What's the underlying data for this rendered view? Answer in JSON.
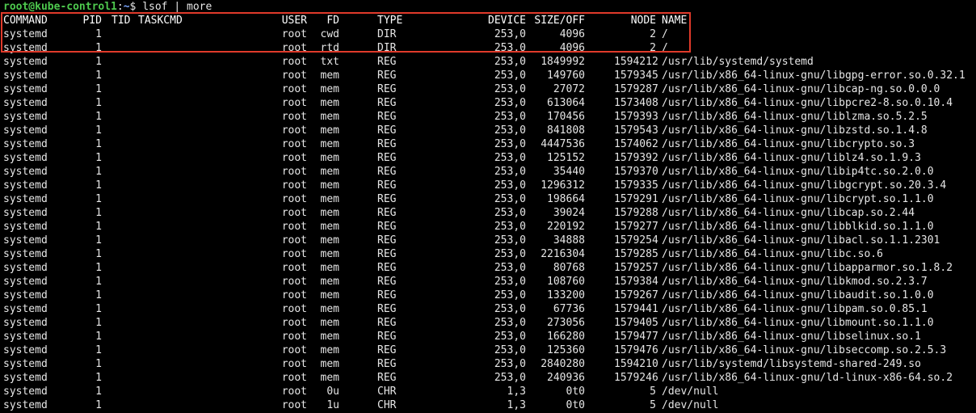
{
  "prompt": {
    "user_host": "root@kube-control1",
    "separator": ":",
    "path": "~",
    "symbol": "$",
    "command": " lsof | more"
  },
  "colors": {
    "background": "#000000",
    "text": "#e6e6e6",
    "prompt_user": "#4ec94e",
    "prompt_path": "#7aa6ff",
    "highlight_box": "#e03a2a"
  },
  "table": {
    "headers": {
      "command": "COMMAND",
      "pid": "PID",
      "tid": "TID",
      "taskcmd": "TASKCMD",
      "user": "USER",
      "fd": "FD",
      "type": "TYPE",
      "device": "DEVICE",
      "size": "SIZE/OFF",
      "node": "NODE",
      "name": "NAME"
    },
    "rows": [
      {
        "command": "systemd",
        "pid": "1",
        "user": "root",
        "fd": "cwd",
        "type": "DIR",
        "device": "253,0",
        "size": "4096",
        "node": "2",
        "name": "/"
      },
      {
        "command": "systemd",
        "pid": "1",
        "user": "root",
        "fd": "rtd",
        "type": "DIR",
        "device": "253,0",
        "size": "4096",
        "node": "2",
        "name": "/"
      },
      {
        "command": "systemd",
        "pid": "1",
        "user": "root",
        "fd": "txt",
        "type": "REG",
        "device": "253,0",
        "size": "1849992",
        "node": "1594212",
        "name": "/usr/lib/systemd/systemd"
      },
      {
        "command": "systemd",
        "pid": "1",
        "user": "root",
        "fd": "mem",
        "type": "REG",
        "device": "253,0",
        "size": "149760",
        "node": "1579345",
        "name": "/usr/lib/x86_64-linux-gnu/libgpg-error.so.0.32.1"
      },
      {
        "command": "systemd",
        "pid": "1",
        "user": "root",
        "fd": "mem",
        "type": "REG",
        "device": "253,0",
        "size": "27072",
        "node": "1579287",
        "name": "/usr/lib/x86_64-linux-gnu/libcap-ng.so.0.0.0"
      },
      {
        "command": "systemd",
        "pid": "1",
        "user": "root",
        "fd": "mem",
        "type": "REG",
        "device": "253,0",
        "size": "613064",
        "node": "1573408",
        "name": "/usr/lib/x86_64-linux-gnu/libpcre2-8.so.0.10.4"
      },
      {
        "command": "systemd",
        "pid": "1",
        "user": "root",
        "fd": "mem",
        "type": "REG",
        "device": "253,0",
        "size": "170456",
        "node": "1579393",
        "name": "/usr/lib/x86_64-linux-gnu/liblzma.so.5.2.5"
      },
      {
        "command": "systemd",
        "pid": "1",
        "user": "root",
        "fd": "mem",
        "type": "REG",
        "device": "253,0",
        "size": "841808",
        "node": "1579543",
        "name": "/usr/lib/x86_64-linux-gnu/libzstd.so.1.4.8"
      },
      {
        "command": "systemd",
        "pid": "1",
        "user": "root",
        "fd": "mem",
        "type": "REG",
        "device": "253,0",
        "size": "4447536",
        "node": "1574062",
        "name": "/usr/lib/x86_64-linux-gnu/libcrypto.so.3"
      },
      {
        "command": "systemd",
        "pid": "1",
        "user": "root",
        "fd": "mem",
        "type": "REG",
        "device": "253,0",
        "size": "125152",
        "node": "1579392",
        "name": "/usr/lib/x86_64-linux-gnu/liblz4.so.1.9.3"
      },
      {
        "command": "systemd",
        "pid": "1",
        "user": "root",
        "fd": "mem",
        "type": "REG",
        "device": "253,0",
        "size": "35440",
        "node": "1579370",
        "name": "/usr/lib/x86_64-linux-gnu/libip4tc.so.2.0.0"
      },
      {
        "command": "systemd",
        "pid": "1",
        "user": "root",
        "fd": "mem",
        "type": "REG",
        "device": "253,0",
        "size": "1296312",
        "node": "1579335",
        "name": "/usr/lib/x86_64-linux-gnu/libgcrypt.so.20.3.4"
      },
      {
        "command": "systemd",
        "pid": "1",
        "user": "root",
        "fd": "mem",
        "type": "REG",
        "device": "253,0",
        "size": "198664",
        "node": "1579291",
        "name": "/usr/lib/x86_64-linux-gnu/libcrypt.so.1.1.0"
      },
      {
        "command": "systemd",
        "pid": "1",
        "user": "root",
        "fd": "mem",
        "type": "REG",
        "device": "253,0",
        "size": "39024",
        "node": "1579288",
        "name": "/usr/lib/x86_64-linux-gnu/libcap.so.2.44"
      },
      {
        "command": "systemd",
        "pid": "1",
        "user": "root",
        "fd": "mem",
        "type": "REG",
        "device": "253,0",
        "size": "220192",
        "node": "1579277",
        "name": "/usr/lib/x86_64-linux-gnu/libblkid.so.1.1.0"
      },
      {
        "command": "systemd",
        "pid": "1",
        "user": "root",
        "fd": "mem",
        "type": "REG",
        "device": "253,0",
        "size": "34888",
        "node": "1579254",
        "name": "/usr/lib/x86_64-linux-gnu/libacl.so.1.1.2301"
      },
      {
        "command": "systemd",
        "pid": "1",
        "user": "root",
        "fd": "mem",
        "type": "REG",
        "device": "253,0",
        "size": "2216304",
        "node": "1579285",
        "name": "/usr/lib/x86_64-linux-gnu/libc.so.6"
      },
      {
        "command": "systemd",
        "pid": "1",
        "user": "root",
        "fd": "mem",
        "type": "REG",
        "device": "253,0",
        "size": "80768",
        "node": "1579257",
        "name": "/usr/lib/x86_64-linux-gnu/libapparmor.so.1.8.2"
      },
      {
        "command": "systemd",
        "pid": "1",
        "user": "root",
        "fd": "mem",
        "type": "REG",
        "device": "253,0",
        "size": "108760",
        "node": "1579384",
        "name": "/usr/lib/x86_64-linux-gnu/libkmod.so.2.3.7"
      },
      {
        "command": "systemd",
        "pid": "1",
        "user": "root",
        "fd": "mem",
        "type": "REG",
        "device": "253,0",
        "size": "133200",
        "node": "1579267",
        "name": "/usr/lib/x86_64-linux-gnu/libaudit.so.1.0.0"
      },
      {
        "command": "systemd",
        "pid": "1",
        "user": "root",
        "fd": "mem",
        "type": "REG",
        "device": "253,0",
        "size": "67736",
        "node": "1579441",
        "name": "/usr/lib/x86_64-linux-gnu/libpam.so.0.85.1"
      },
      {
        "command": "systemd",
        "pid": "1",
        "user": "root",
        "fd": "mem",
        "type": "REG",
        "device": "253,0",
        "size": "273056",
        "node": "1579405",
        "name": "/usr/lib/x86_64-linux-gnu/libmount.so.1.1.0"
      },
      {
        "command": "systemd",
        "pid": "1",
        "user": "root",
        "fd": "mem",
        "type": "REG",
        "device": "253,0",
        "size": "166280",
        "node": "1579477",
        "name": "/usr/lib/x86_64-linux-gnu/libselinux.so.1"
      },
      {
        "command": "systemd",
        "pid": "1",
        "user": "root",
        "fd": "mem",
        "type": "REG",
        "device": "253,0",
        "size": "125360",
        "node": "1579476",
        "name": "/usr/lib/x86_64-linux-gnu/libseccomp.so.2.5.3"
      },
      {
        "command": "systemd",
        "pid": "1",
        "user": "root",
        "fd": "mem",
        "type": "REG",
        "device": "253,0",
        "size": "2840280",
        "node": "1594210",
        "name": "/usr/lib/systemd/libsystemd-shared-249.so"
      },
      {
        "command": "systemd",
        "pid": "1",
        "user": "root",
        "fd": "mem",
        "type": "REG",
        "device": "253,0",
        "size": "240936",
        "node": "1579246",
        "name": "/usr/lib/x86_64-linux-gnu/ld-linux-x86-64.so.2"
      },
      {
        "command": "systemd",
        "pid": "1",
        "user": "root",
        "fd": "0u",
        "type": "CHR",
        "device": "1,3",
        "size": "0t0",
        "node": "5",
        "name": "/dev/null"
      },
      {
        "command": "systemd",
        "pid": "1",
        "user": "root",
        "fd": "1u",
        "type": "CHR",
        "device": "1,3",
        "size": "0t0",
        "node": "5",
        "name": "/dev/null"
      }
    ]
  }
}
